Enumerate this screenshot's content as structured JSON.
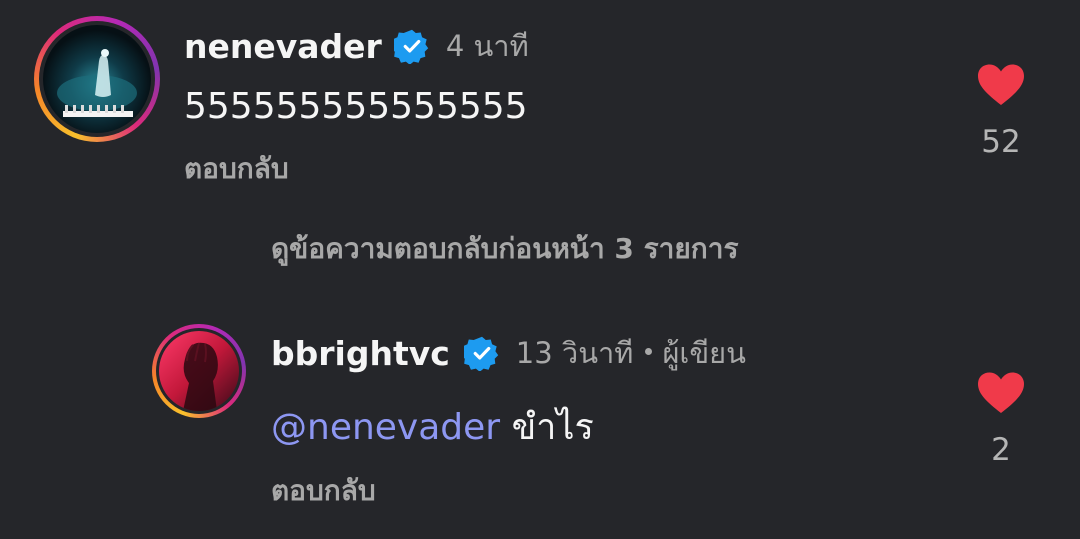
{
  "comments": [
    {
      "username": "nenevader",
      "time": "4 นาที",
      "text": "555555555555555",
      "reply_label": "ตอบกลับ",
      "likes": "52",
      "verified": true
    },
    {
      "username": "bbrightvc",
      "time": "13 วินาที",
      "author_label": "ผู้เขียน",
      "mention": "@nenevader",
      "text": "ขำไร",
      "reply_label": "ตอบกลับ",
      "likes": "2",
      "verified": true
    }
  ],
  "view_previous_replies": "ดูข้อความตอบกลับก่อนหน้า 3 รายการ",
  "colors": {
    "background": "#25262a",
    "heart": "#f03a4a",
    "verified": "#1d9bf0",
    "mention": "#8d97f2",
    "secondary_text": "#a8a8a8"
  }
}
